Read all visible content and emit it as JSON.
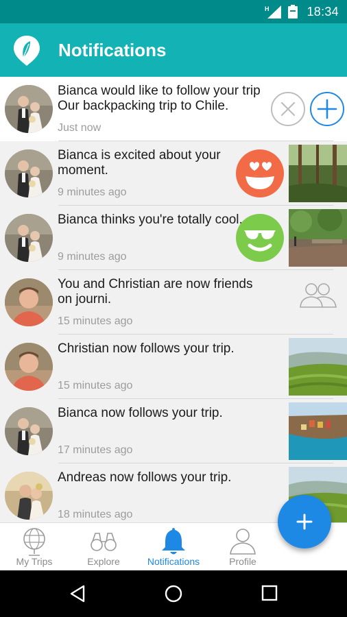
{
  "status_bar": {
    "network": "H",
    "time": "18:34"
  },
  "app_bar": {
    "title": "Notifications",
    "logo_icon": "leaf-logo-icon"
  },
  "notifications": [
    {
      "avatar": "bianca",
      "text": "Bianca would like to follow your trip Our backpacking trip to Chile.",
      "time": "Just now",
      "unread": true,
      "actions": [
        "decline",
        "accept"
      ]
    },
    {
      "avatar": "bianca",
      "text": "Bianca is excited about your moment.",
      "time": "9 minutes ago",
      "reaction": "heart-eyes-emoji",
      "reaction_color": "#f26b47",
      "thumb": "forest"
    },
    {
      "avatar": "bianca",
      "text": "Bianca thinks you're totally cool.",
      "time": "9 minutes ago",
      "reaction": "sunglasses-emoji",
      "reaction_color": "#7ccb4a",
      "thumb": "park"
    },
    {
      "avatar": "christian",
      "text": "You and Christian are now friends on journi.",
      "time": "15 minutes ago",
      "icon": "friends-icon"
    },
    {
      "avatar": "christian",
      "text": "Christian now follows your trip.",
      "time": "15 minutes ago",
      "thumb": "tea-hills"
    },
    {
      "avatar": "bianca",
      "text": "Bianca now follows your trip.",
      "time": "17 minutes ago",
      "thumb": "coast-village"
    },
    {
      "avatar": "andreas",
      "text": "Andreas now follows your trip.",
      "time": "18 minutes ago",
      "thumb": "tea-hills"
    }
  ],
  "bottom_nav": [
    {
      "label": "My Trips",
      "icon": "globe-icon",
      "active": false
    },
    {
      "label": "Explore",
      "icon": "binoculars-icon",
      "active": false
    },
    {
      "label": "Notifications",
      "icon": "bell-icon",
      "active": true
    },
    {
      "label": "Profile",
      "icon": "person-icon",
      "active": false
    }
  ],
  "colors": {
    "app_bar": "#13b2b5",
    "status_bar": "#008b8b",
    "accent": "#1e88e5"
  }
}
